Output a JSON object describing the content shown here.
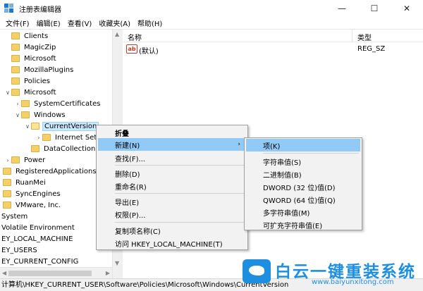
{
  "window": {
    "title": "注册表编辑器",
    "minimize": "—",
    "maximize": "☐",
    "close": "✕"
  },
  "menu": [
    "文件(F)",
    "编辑(E)",
    "查看(V)",
    "收藏夹(A)",
    "帮助(H)"
  ],
  "tree": [
    {
      "label": "Clients",
      "level": 0,
      "arrow": "",
      "folder": true
    },
    {
      "label": "MagicZip",
      "level": 0,
      "arrow": "",
      "folder": true
    },
    {
      "label": "Microsoft",
      "level": 0,
      "arrow": "",
      "folder": true
    },
    {
      "label": "MozillaPlugins",
      "level": 0,
      "arrow": "",
      "folder": true
    },
    {
      "label": "Policies",
      "level": 0,
      "arrow": "",
      "folder": true
    },
    {
      "label": "Microsoft",
      "level": 0,
      "arrow": "∨",
      "folder": true
    },
    {
      "label": "SystemCertificates",
      "level": 1,
      "arrow": "›",
      "folder": true
    },
    {
      "label": "Windows",
      "level": 1,
      "arrow": "∨",
      "folder": true
    },
    {
      "label": "CurrentVersion",
      "level": 2,
      "arrow": "∨",
      "folder": true,
      "selected": true
    },
    {
      "label": "Internet Sett",
      "level": 3,
      "arrow": "›",
      "folder": true
    },
    {
      "label": "DataCollection",
      "level": 2,
      "arrow": "",
      "folder": true
    },
    {
      "label": "Power",
      "level": 0,
      "arrow": "›",
      "folder": true
    },
    {
      "label": "RegisteredApplications",
      "level": -1,
      "arrow": "",
      "folder": true
    },
    {
      "label": "RuanMei",
      "level": -1,
      "arrow": "",
      "folder": true
    },
    {
      "label": "SyncEngines",
      "level": -1,
      "arrow": "",
      "folder": true
    },
    {
      "label": "VMware, Inc.",
      "level": -1,
      "arrow": "",
      "folder": true
    },
    {
      "label": "System",
      "level": -2,
      "arrow": "",
      "folder": false
    },
    {
      "label": "Volatile Environment",
      "level": -2,
      "arrow": "",
      "folder": false
    },
    {
      "label": "EY_LOCAL_MACHINE",
      "level": -2,
      "arrow": "",
      "folder": false
    },
    {
      "label": "EY_USERS",
      "level": -2,
      "arrow": "",
      "folder": false
    },
    {
      "label": "EY_CURRENT_CONFIG",
      "level": -2,
      "arrow": "",
      "folder": false
    }
  ],
  "columns": {
    "name": "名称",
    "type": "类型"
  },
  "values": [
    {
      "name": "(默认)",
      "type": "REG_SZ",
      "icon": "string-value-icon"
    }
  ],
  "icon_text": "ab",
  "context_menu": [
    {
      "label": "折叠",
      "bold": true
    },
    {
      "label": "新建(N)",
      "highlight": true,
      "submenu": true,
      "arrow": "›"
    },
    {
      "label": "查找(F)..."
    },
    {
      "label": "删除(D)"
    },
    {
      "label": "重命名(R)"
    },
    {
      "label": "导出(E)"
    },
    {
      "label": "权限(P)..."
    },
    {
      "label": "复制项名称(C)"
    },
    {
      "label": "访问 HKEY_LOCAL_MACHINE(T)"
    }
  ],
  "submenu": [
    {
      "label": "项(K)",
      "highlight": true
    },
    {
      "label": "字符串值(S)"
    },
    {
      "label": "二进制值(B)"
    },
    {
      "label": "DWORD (32 位)值(D)"
    },
    {
      "label": "QWORD (64 位)值(Q)"
    },
    {
      "label": "多字符串值(M)"
    },
    {
      "label": "可扩充字符串值(E)"
    }
  ],
  "status": "计算机\\HKEY_CURRENT_USER\\Software\\Policies\\Microsoft\\Windows\\CurrentVersion",
  "watermark": {
    "text": "白云一键重装系统",
    "url": "www.baiyunxitong.com"
  },
  "colors": {
    "accent": "#1e78d2",
    "selection": "#cce8ff",
    "menu_highlight": "#91c9f7",
    "watermark": "#1e8ee0"
  }
}
